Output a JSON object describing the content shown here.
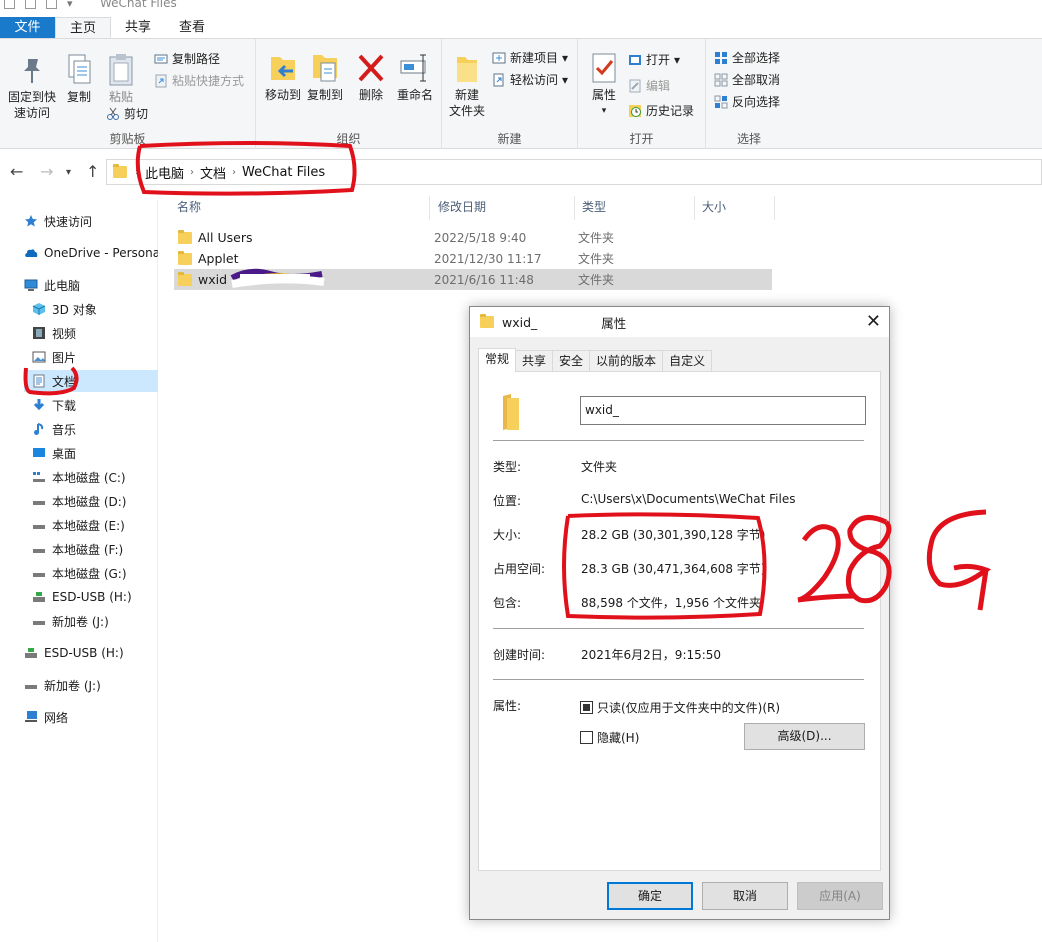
{
  "window": {
    "title": "WeChat Files"
  },
  "ribbon_tabs": [
    "文件",
    "主页",
    "共享",
    "查看"
  ],
  "ribbon": {
    "clipboard": {
      "label": "剪贴板",
      "pin_quick_access": "固定到快速访问",
      "pin_line1": "固定到快",
      "pin_line2": "速访问",
      "copy": "复制",
      "paste": "粘贴",
      "copy_path": "复制路径",
      "paste_shortcut": "粘贴快捷方式",
      "cut": "剪切"
    },
    "organize": {
      "label": "组织",
      "move_to": "移动到",
      "copy_to": "复制到",
      "delete": "删除",
      "rename": "重命名"
    },
    "new": {
      "label": "新建",
      "new_folder_line1": "新建",
      "new_folder_line2": "文件夹",
      "new_item": "新建项目",
      "easy_access": "轻松访问"
    },
    "open": {
      "label": "打开",
      "properties": "属性",
      "open": "打开",
      "edit": "编辑",
      "history": "历史记录"
    },
    "select": {
      "label": "选择",
      "select_all": "全部选择",
      "select_none": "全部取消",
      "invert": "反向选择"
    }
  },
  "breadcrumb": [
    "此电脑",
    "文档",
    "WeChat Files"
  ],
  "sidebar": [
    {
      "label": "快速访问",
      "icon": "star-icon"
    },
    {
      "label": "OneDrive - Persona",
      "icon": "cloud-icon"
    },
    {
      "label": "此电脑",
      "icon": "computer-icon"
    },
    {
      "label": "3D 对象",
      "icon": "cube-icon"
    },
    {
      "label": "视频",
      "icon": "video-icon"
    },
    {
      "label": "图片",
      "icon": "picture-icon"
    },
    {
      "label": "文档",
      "icon": "document-icon"
    },
    {
      "label": "下载",
      "icon": "download-icon"
    },
    {
      "label": "音乐",
      "icon": "music-icon"
    },
    {
      "label": "桌面",
      "icon": "desktop-icon"
    },
    {
      "label": "本地磁盘 (C:)",
      "icon": "drive-icon"
    },
    {
      "label": "本地磁盘 (D:)",
      "icon": "drive-icon"
    },
    {
      "label": "本地磁盘 (E:)",
      "icon": "drive-icon"
    },
    {
      "label": "本地磁盘 (F:)",
      "icon": "drive-icon"
    },
    {
      "label": "本地磁盘 (G:)",
      "icon": "drive-icon"
    },
    {
      "label": "ESD-USB (H:)",
      "icon": "usb-icon"
    },
    {
      "label": "新加卷 (J:)",
      "icon": "drive-icon"
    },
    {
      "label": "ESD-USB (H:)",
      "icon": "usb-icon"
    },
    {
      "label": "新加卷 (J:)",
      "icon": "drive-icon"
    },
    {
      "label": "网络",
      "icon": "network-icon"
    }
  ],
  "columns": [
    "名称",
    "修改日期",
    "类型",
    "大小"
  ],
  "files": [
    {
      "name": "All Users",
      "date": "2022/5/18 9:40",
      "type": "文件夹"
    },
    {
      "name": "Applet",
      "date": "2021/12/30 11:17",
      "type": "文件夹"
    },
    {
      "name": "wxid",
      "date": "2021/6/16 11:48",
      "type": "文件夹"
    }
  ],
  "dialog": {
    "title_prefix": "wxid_",
    "title_suffix": "属性",
    "tabs": [
      "常规",
      "共享",
      "安全",
      "以前的版本",
      "自定义"
    ],
    "name_value": "wxid_",
    "type_label": "类型:",
    "type_value": "文件夹",
    "location_label": "位置:",
    "location_value": "C:\\Users\\x\\Documents\\WeChat Files",
    "size_label": "大小:",
    "size_value": "28.2 GB (30,301,390,128 字节)",
    "disk_label": "占用空间:",
    "disk_value": "28.3 GB (30,471,364,608 字节)",
    "contains_label": "包含:",
    "contains_value": "88,598 个文件，1,956 个文件夹",
    "created_label": "创建时间:",
    "created_value": "2021年6月2日，9:15:50",
    "attributes_label": "属性:",
    "readonly": "只读(仅应用于文件夹中的文件)(R)",
    "hidden": "隐藏(H)",
    "advanced": "高级(D)...",
    "ok": "确定",
    "cancel": "取消",
    "apply": "应用(A)"
  },
  "annotation": {
    "handwritten": "28G",
    "color": "#e0111b"
  }
}
